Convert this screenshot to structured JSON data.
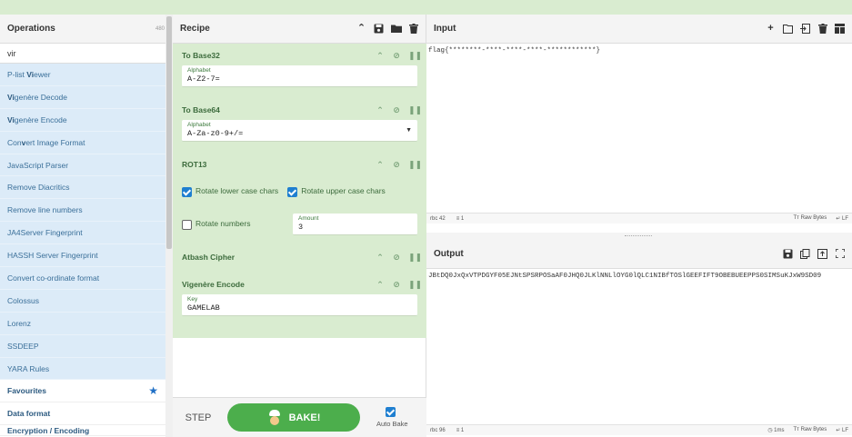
{
  "operations": {
    "title": "Operations",
    "count": "480",
    "search_value": "vir",
    "items": [
      {
        "pre": "P-list ",
        "match": "Vi",
        "post": "ewer"
      },
      {
        "pre": "",
        "match": "Vi",
        "post": "genère Decode"
      },
      {
        "pre": "",
        "match": "Vi",
        "post": "genère Encode"
      },
      {
        "pre": "Con",
        "match": "v",
        "post": "ert Image Format"
      },
      {
        "pre": "JavaScript Parser",
        "match": "",
        "post": ""
      },
      {
        "pre": "Remove Diacritics",
        "match": "",
        "post": ""
      },
      {
        "pre": "Remove line numbers",
        "match": "",
        "post": ""
      },
      {
        "pre": "JA4Server Fingerprint",
        "match": "",
        "post": ""
      },
      {
        "pre": "HASSH Server Fingerprint",
        "match": "",
        "post": ""
      },
      {
        "pre": "Convert co-ordinate format",
        "match": "",
        "post": ""
      },
      {
        "pre": "Colossus",
        "match": "",
        "post": ""
      },
      {
        "pre": "Lorenz",
        "match": "",
        "post": ""
      },
      {
        "pre": "SSDEEP",
        "match": "",
        "post": ""
      },
      {
        "pre": "YARA Rules",
        "match": "",
        "post": ""
      }
    ],
    "categories": [
      "Favourites",
      "Data format",
      "Encryption / Encoding"
    ]
  },
  "recipe": {
    "title": "Recipe",
    "ops": [
      {
        "name": "To Base32",
        "field_label": "Alphabet",
        "field_value": "A-Z2-7="
      },
      {
        "name": "To Base64",
        "field_label": "Alphabet",
        "field_value": "A-Za-z0-9+/="
      },
      {
        "name": "ROT13",
        "check1": "Rotate lower case chars",
        "check2": "Rotate upper case chars",
        "check3": "Rotate numbers",
        "amount_label": "Amount",
        "amount_value": "3"
      },
      {
        "name": "Atbash Cipher"
      },
      {
        "name": "Vigenère Encode",
        "field_label": "Key",
        "field_value": "GAMELAB"
      }
    ],
    "step_label": "STEP",
    "bake_label": "BAKE!",
    "autobake_label": "Auto Bake"
  },
  "input": {
    "title": "Input",
    "text": "flag{********-****-****-****-************}",
    "chars": "42",
    "lines": "1",
    "raw_bytes": "Raw Bytes",
    "eol": "LF"
  },
  "output": {
    "title": "Output",
    "text": "JBtDQ0JxQxVTPDGYF05EJNtSPSRPOSaAF0JHQ0JLKlNNLlOYG0lQLC1NIBfTOSlGEEFIFT9OBEBUEEPPS0SIMSuKJxW9SD09",
    "chars": "96",
    "lines": "1",
    "time": "1ms",
    "raw_bytes": "Raw Bytes",
    "eol": "LF"
  }
}
